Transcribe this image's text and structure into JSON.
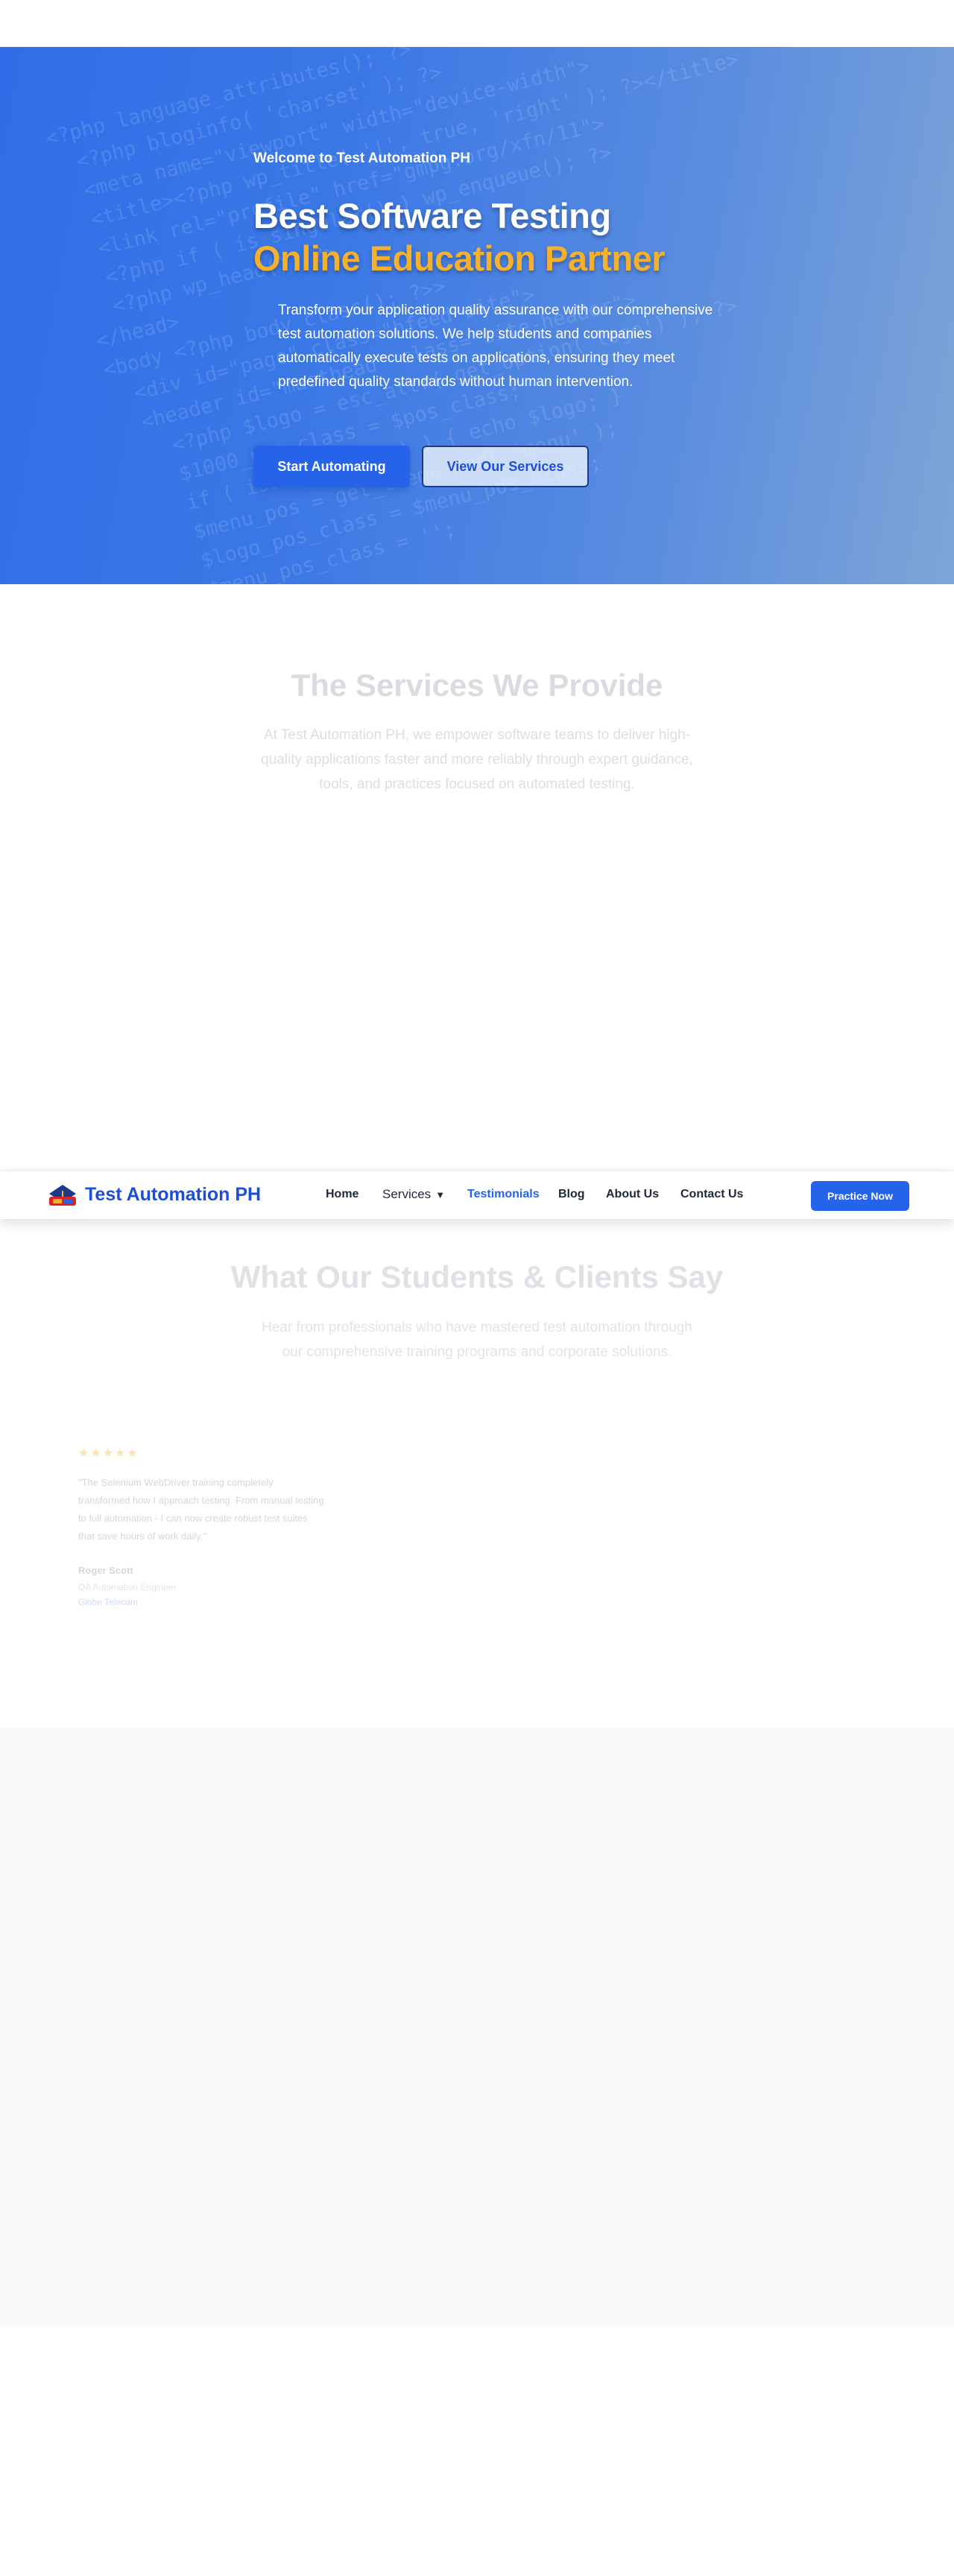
{
  "hero": {
    "welcome": "Welcome to Test Automation PH",
    "title_line1": "Best Software Testing",
    "title_line2": "Online Education Partner",
    "description": "Transform your application quality assurance with our comprehensive test automation solutions. We help students and companies automatically execute tests on applications, ensuring they meet predefined quality standards without human intervention.",
    "primary_button": "Start Automating",
    "secondary_button": "View Our Services"
  },
  "services": {
    "title": "The Services We Provide",
    "description": "At Test Automation PH, we empower software teams to deliver high-quality applications faster and more reliably through expert guidance, tools, and practices focused on automated testing."
  },
  "navbar": {
    "logo_text": "Test Automation PH",
    "items": [
      {
        "label": "Home"
      },
      {
        "label": "Services"
      },
      {
        "label": "Testimonials"
      },
      {
        "label": "Blog"
      },
      {
        "label": "About Us"
      },
      {
        "label": "Contact Us"
      }
    ],
    "caret": "▼",
    "cta": "Practice Now"
  },
  "testimonials": {
    "title": "What Our Students & Clients Say",
    "description": "Hear from professionals who have mastered test automation through our comprehensive training programs and corporate solutions.",
    "cards": [
      {
        "stars": "★★★★★",
        "quote": "\"The Selenium WebDriver training completely transformed how I approach testing. From manual testing to full automation - I can now create robust test suites that save hours of work daily.\"",
        "author": "Roger Scott",
        "role": "QA Automation Engineer",
        "company": "Globe Telecom"
      }
    ]
  },
  "colors": {
    "primary": "#2563eb",
    "accent": "#f5b02e",
    "hero_gradient_start": "#2f6ee8",
    "hero_gradient_end": "#7ea5d6",
    "band_grey": "#f8f9fb"
  }
}
